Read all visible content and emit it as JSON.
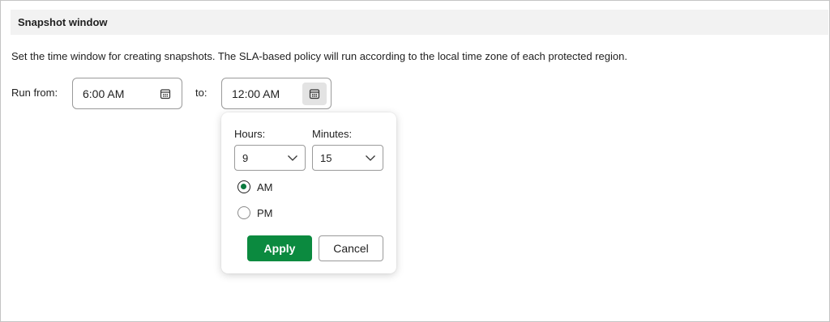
{
  "section": {
    "title": "Snapshot window",
    "description": "Set the time window for creating snapshots. The SLA-based policy will run according to the local time zone of each protected region."
  },
  "run_from": {
    "label": "Run from:",
    "value": "6:00 AM",
    "icon": "calendar-icon"
  },
  "run_to": {
    "label": "to:",
    "value": "12:00 AM",
    "icon": "calendar-icon"
  },
  "time_picker": {
    "hours_label": "Hours:",
    "hours_value": "9",
    "minutes_label": "Minutes:",
    "minutes_value": "15",
    "period_options": [
      "AM",
      "PM"
    ],
    "selected_period": "AM",
    "apply_label": "Apply",
    "cancel_label": "Cancel"
  },
  "colors": {
    "accent": "#0b8a3f",
    "header_bg": "#f2f2f2"
  }
}
